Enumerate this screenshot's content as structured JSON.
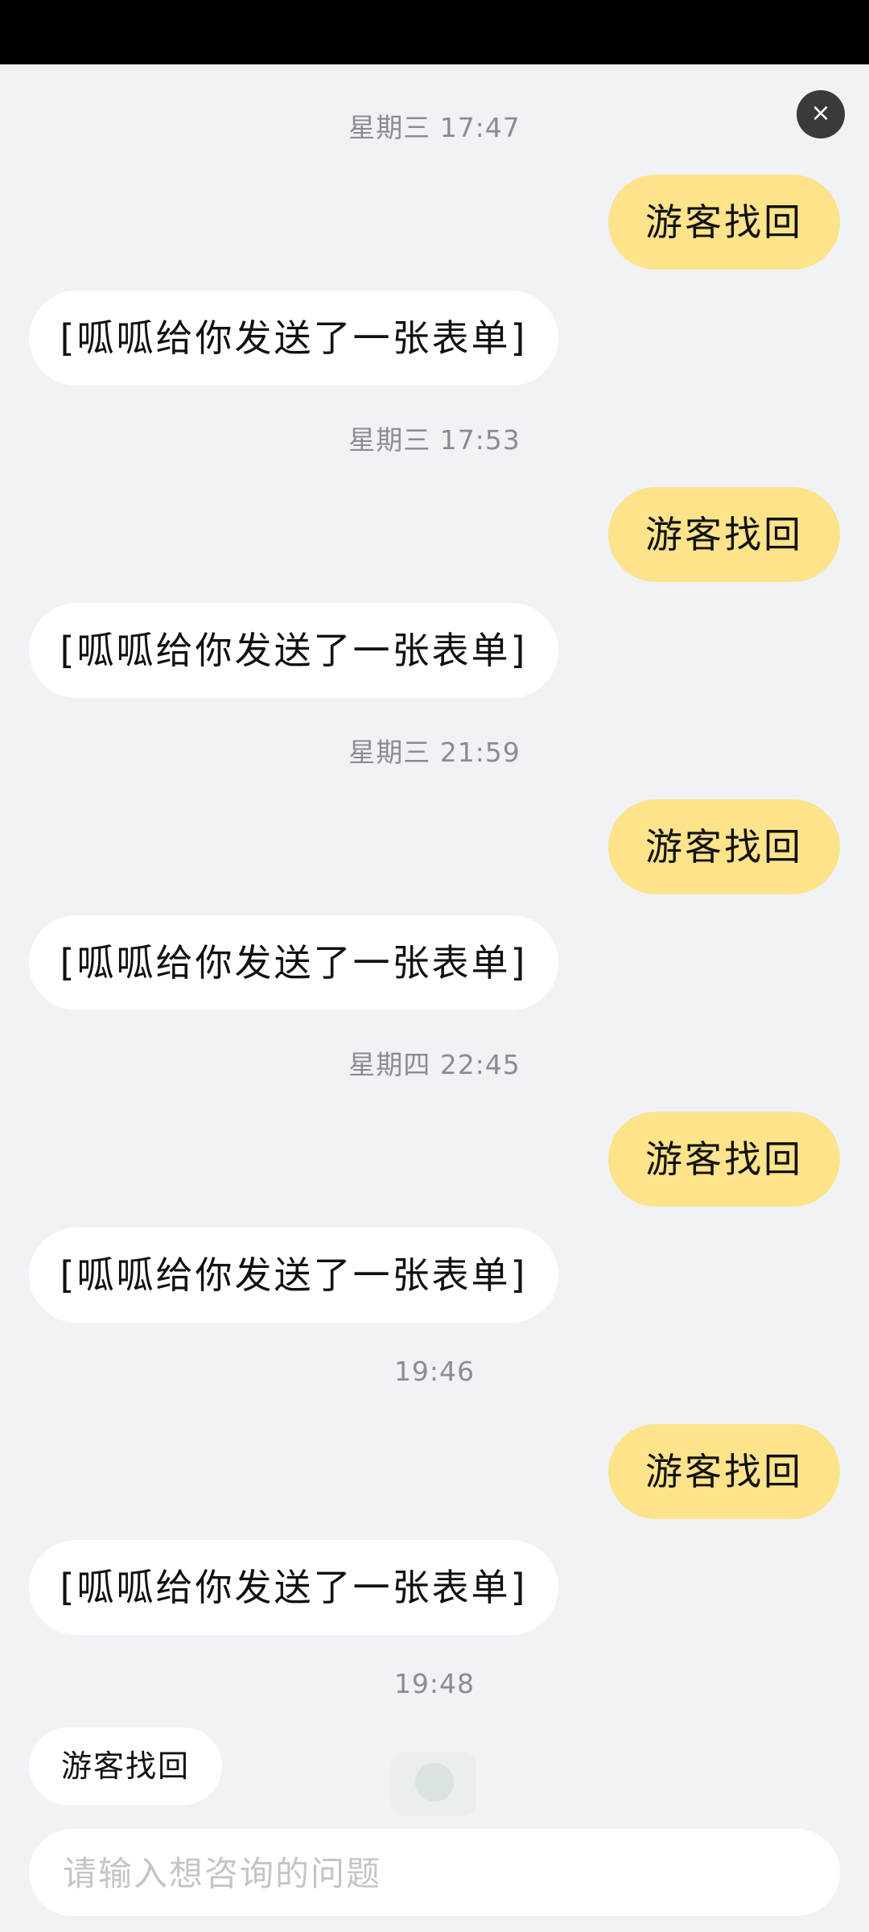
{
  "close_button": {
    "label": "×"
  },
  "messages": [
    {
      "timestamp": "星期三 17:47",
      "sent": "游客找回",
      "received": "[呱呱给你发送了一张表单]"
    },
    {
      "timestamp": "星期三 17:53",
      "sent": "游客找回",
      "received": "[呱呱给你发送了一张表单]"
    },
    {
      "timestamp": "星期三 21:59",
      "sent": "游客找回",
      "received": "[呱呱给你发送了一张表单]"
    },
    {
      "timestamp": "星期四 22:45",
      "sent": "游客找回",
      "received": "[呱呱给你发送了一张表单]"
    },
    {
      "timestamp": "19:46",
      "sent": "游客找回",
      "received": "[呱呱给你发送了一张表单]"
    }
  ],
  "last_timestamp": "19:48",
  "quick_reply": {
    "label": "游客找回"
  },
  "input": {
    "placeholder": "请输入想咨询的问题",
    "value": ""
  },
  "colors": {
    "background": "#f1f2f5",
    "sent_bubble": "#fde38a",
    "received_bubble": "#ffffff",
    "timestamp": "#8a8c91"
  }
}
